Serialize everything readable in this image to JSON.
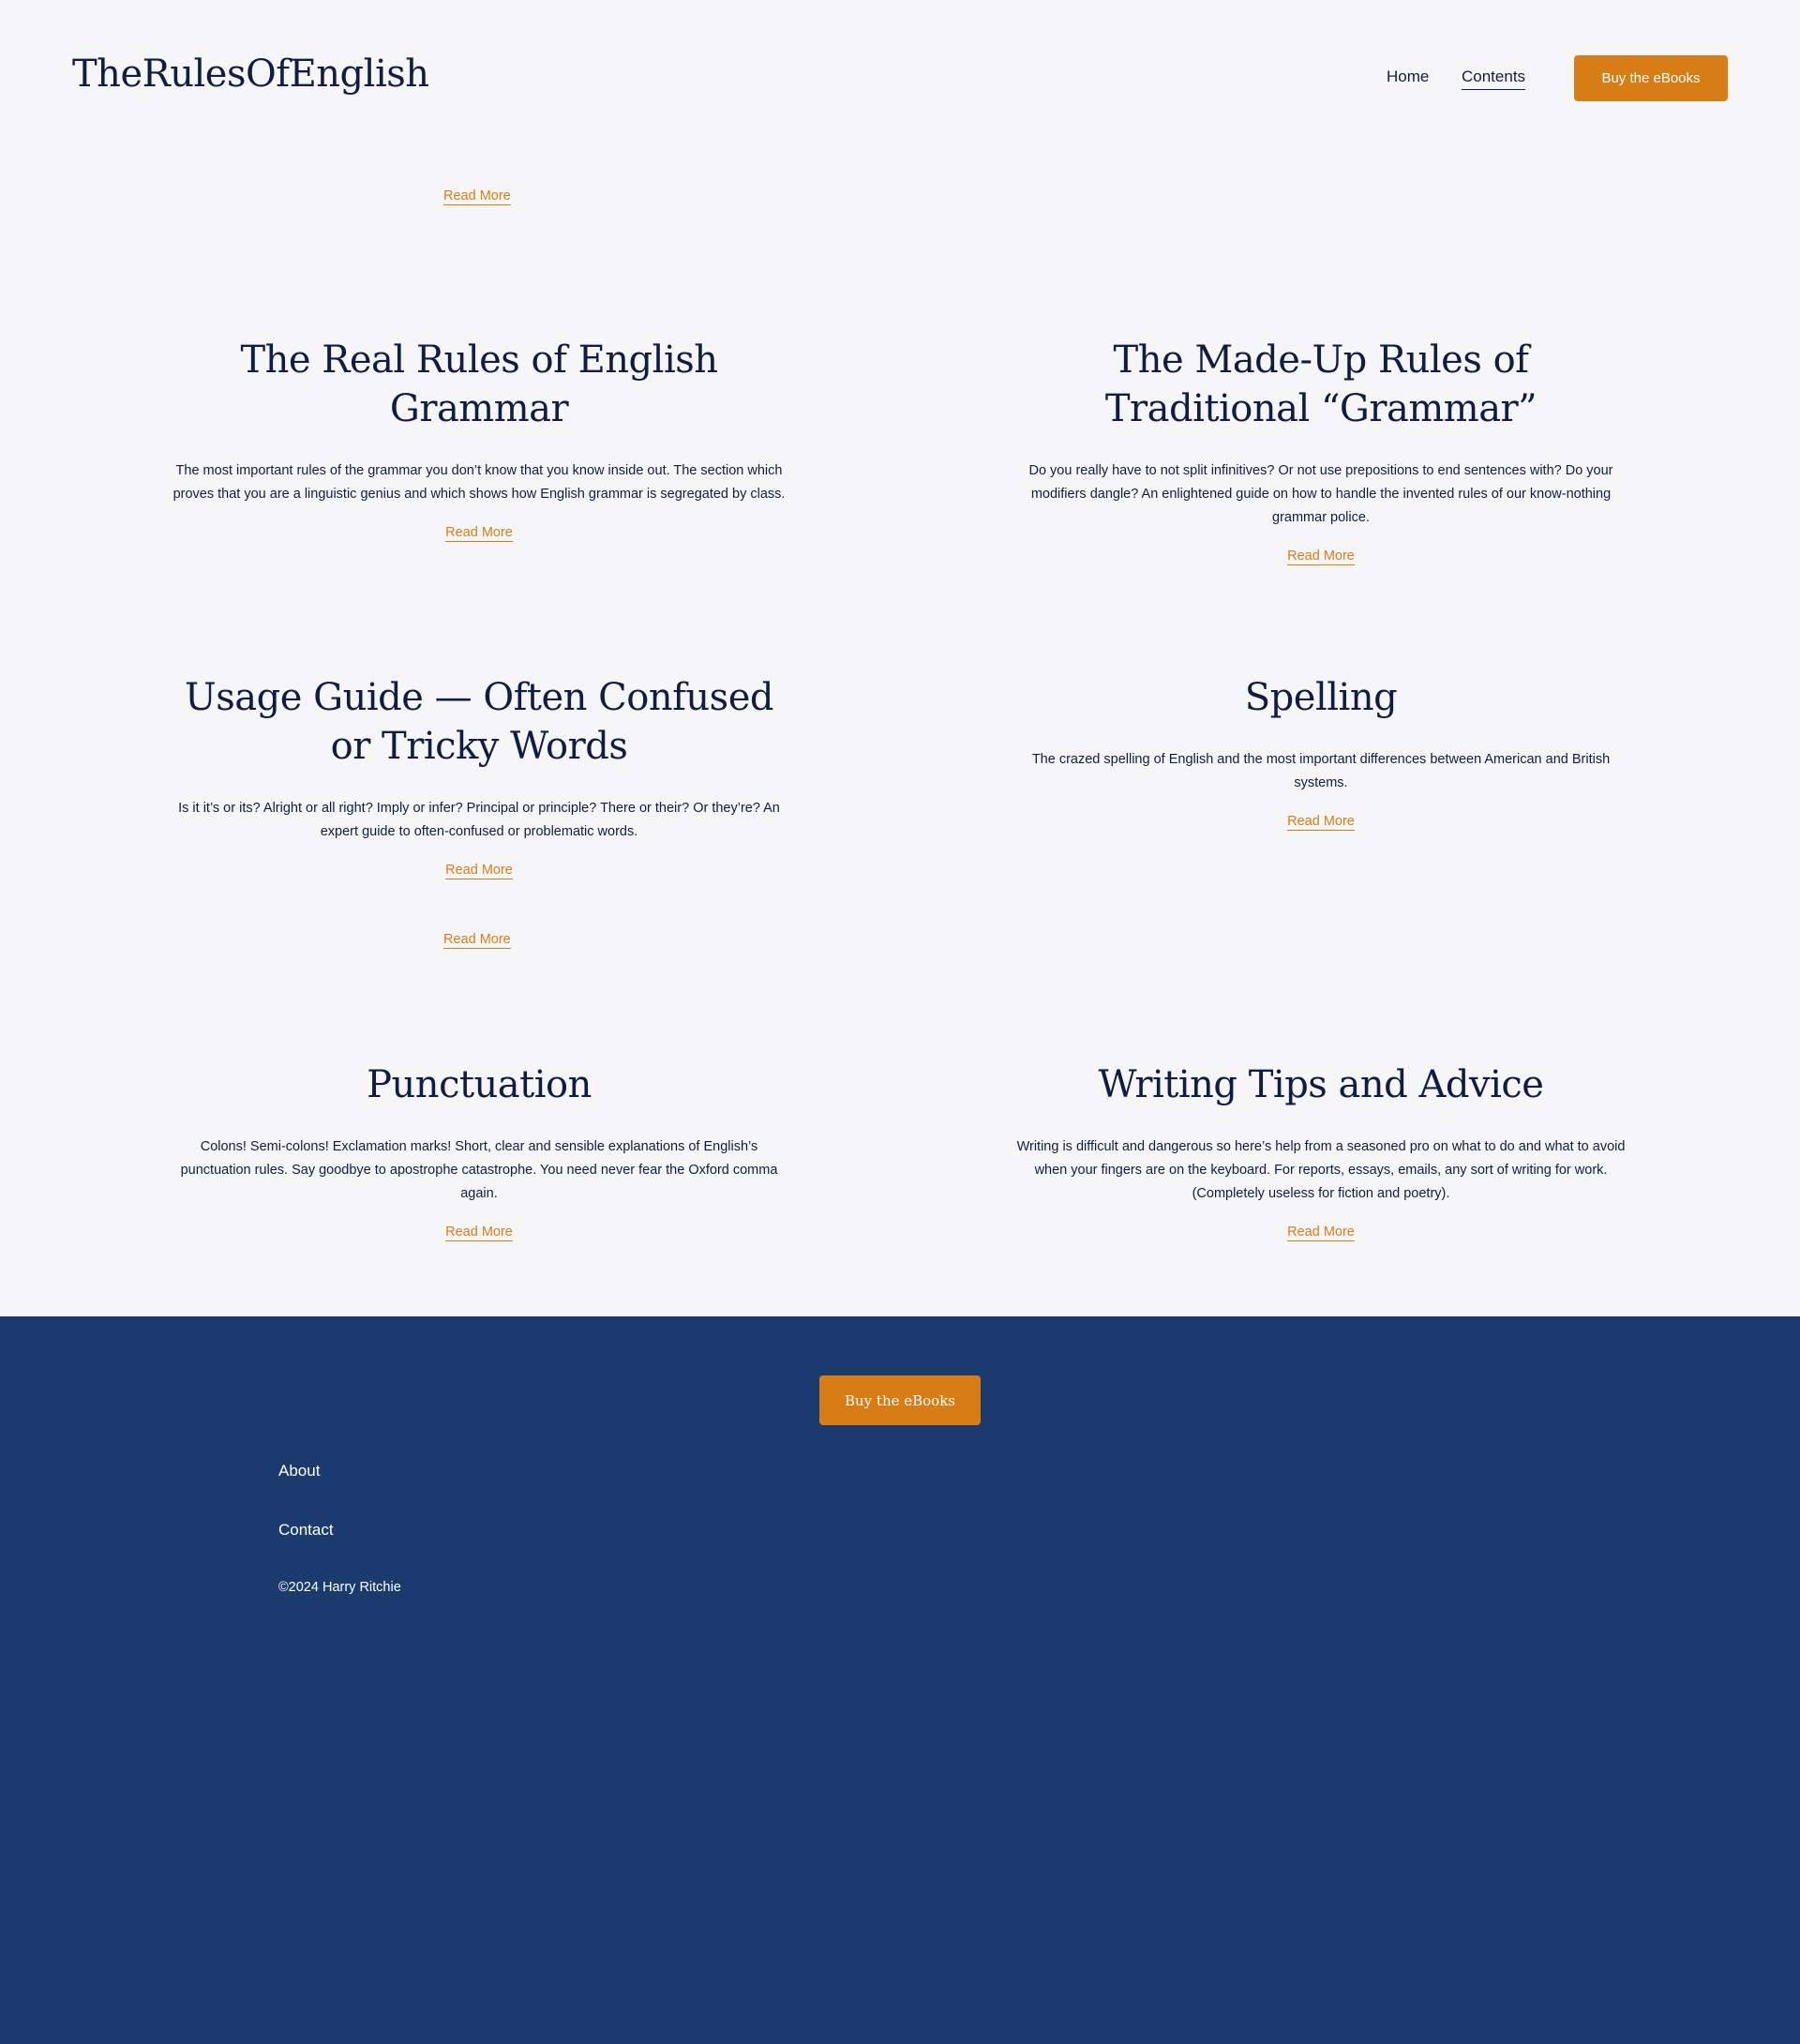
{
  "header": {
    "logo": "TheRulesOfEnglish",
    "nav": {
      "home": "Home",
      "contents": "Contents"
    },
    "cta": "Buy the eBooks"
  },
  "top_read_more": "Read More",
  "sections": [
    {
      "title": "The Real Rules of English Grammar",
      "description": "The most important rules of the grammar you don’t know that you know inside out. The section which proves that you are a linguistic genius and which shows how English grammar is segregated by class.",
      "link": "Read More"
    },
    {
      "title": "The Made-Up Rules of Traditional “Grammar”",
      "description": "Do you really have to not split infinitives? Or not use prepositions to end sentences with? Do your modifiers dangle? An enlightened guide on how to handle the invented rules of our know-nothing grammar police.",
      "link": "Read More"
    },
    {
      "title": "Usage Guide — Often Confused or Tricky Words",
      "description": "Is it it’s or its? Alright or all right? Imply or infer? Principal or principle? There or their? Or they’re? An expert guide to often-confused or problematic words.",
      "link": "Read More"
    },
    {
      "title": "Spelling",
      "description": "The crazed spelling of English and the most important differences between American and British systems.",
      "link": "Read More"
    },
    {
      "title": "Punctuation",
      "description": "Colons! Semi-colons! Exclamation marks! Short, clear and sensible explanations of English’s punctuation rules. Say goodbye to apostrophe catastrophe. You need never fear the Oxford comma again.",
      "link": "Read More"
    },
    {
      "title": "Writing Tips and Advice",
      "description": "Writing is difficult and dangerous so here’s help from a seasoned pro on what to do and what to avoid when your fingers are on the keyboard. For reports, essays, emails, any sort of writing for work. (Completely useless for fiction and poetry).",
      "link": "Read More"
    }
  ],
  "extra_read_more": "Read More",
  "footer": {
    "cta": "Buy the eBooks",
    "about": "About",
    "contact": "Contact",
    "copyright": "©2024 Harry Ritchie"
  },
  "colors": {
    "background": "#f6f6f8",
    "text": "#0f1d45",
    "accent": "#d87d16",
    "footer": "#1b3a6e"
  }
}
